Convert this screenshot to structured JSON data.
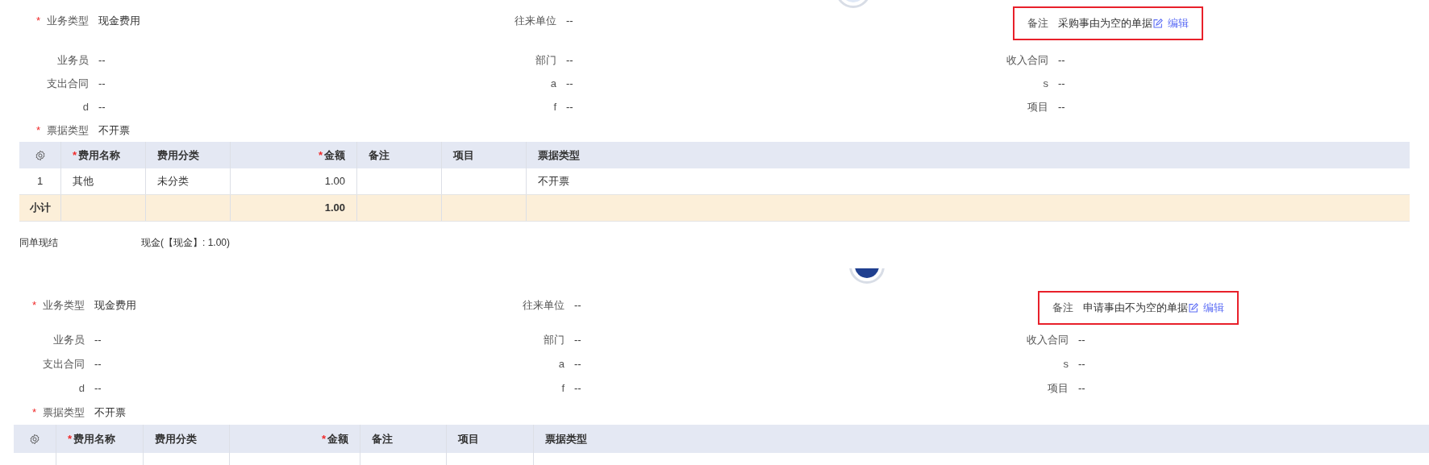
{
  "panels": [
    {
      "fields": [
        [
          {
            "mark": "*",
            "label": "业务类型",
            "value": "现金费用"
          },
          {
            "label": "往来单位",
            "value": "--"
          },
          {
            "kind": "note",
            "label": "备注",
            "value": "采购事由为空的单据",
            "link": "编辑",
            "highlighted": true
          }
        ],
        [
          {
            "label": "业务员",
            "value": "--"
          },
          {
            "label": "部门",
            "value": "--"
          },
          {
            "label": "收入合同",
            "value": "--"
          }
        ],
        [
          {
            "label": "支出合同",
            "value": "--"
          },
          {
            "label": "a",
            "value": "--"
          },
          {
            "label": "s",
            "value": "--"
          }
        ],
        [
          {
            "label": "d",
            "value": "--"
          },
          {
            "label": "f",
            "value": "--"
          },
          {
            "label": "项目",
            "value": "--"
          }
        ],
        [
          {
            "mark": "*",
            "label": "票据类型",
            "value": "不开票"
          }
        ]
      ],
      "table": {
        "columns": [
          {
            "kind": "settings"
          },
          {
            "label": "费用名称",
            "mark": "*"
          },
          {
            "label": "费用分类"
          },
          {
            "label": "金额",
            "mark": "*",
            "kind": "numeric"
          },
          {
            "label": "备注"
          },
          {
            "label": "项目"
          },
          {
            "label": "票据类型"
          }
        ],
        "rows": [
          [
            "1",
            "其他",
            "未分类",
            "1.00",
            null,
            null,
            "不开票"
          ]
        ],
        "subtotal": {
          "label": "小计",
          "amount": "1.00"
        }
      },
      "settlement": {
        "label": "同单现结",
        "value": "现金(【现金】: 1.00)"
      }
    },
    {
      "fields": [
        [
          {
            "mark": "*",
            "label": "业务类型",
            "value": "现金费用"
          },
          {
            "label": "往来单位",
            "value": "--"
          },
          {
            "kind": "note",
            "label": "备注",
            "value": "申请事由不为空的单据",
            "link": "编辑",
            "highlighted": true
          }
        ],
        [
          {
            "label": "业务员",
            "value": "--"
          },
          {
            "label": "部门",
            "value": "--"
          },
          {
            "label": "收入合同",
            "value": "--"
          }
        ],
        [
          {
            "label": "支出合同",
            "value": "--"
          },
          {
            "label": "a",
            "value": "--"
          },
          {
            "label": "s",
            "value": "--"
          }
        ],
        [
          {
            "label": "d",
            "value": "--"
          },
          {
            "label": "f",
            "value": "--"
          },
          {
            "label": "项目",
            "value": "--"
          }
        ],
        [
          {
            "mark": "*",
            "label": "票据类型",
            "value": "不开票"
          }
        ]
      ],
      "table": {
        "columns": [
          {
            "kind": "settings"
          },
          {
            "label": "费用名称",
            "mark": "*"
          },
          {
            "label": "费用分类"
          },
          {
            "label": "金额",
            "mark": "*",
            "kind": "numeric"
          },
          {
            "label": "备注"
          },
          {
            "label": "项目"
          },
          {
            "label": "票据类型"
          }
        ]
      }
    }
  ]
}
